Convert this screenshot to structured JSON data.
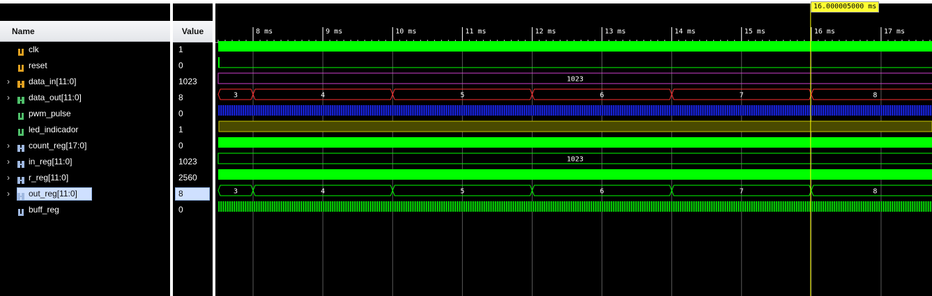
{
  "header": {
    "name_col": "Name",
    "value_col": "Value"
  },
  "signals": [
    {
      "name": "clk",
      "value": "1",
      "bus": false,
      "icon": "bit-signal-icon",
      "icon_color": "#e0a020"
    },
    {
      "name": "reset",
      "value": "0",
      "bus": false,
      "icon": "bit-signal-icon",
      "icon_color": "#e0a020"
    },
    {
      "name": "data_in[11:0]",
      "value": "1023",
      "bus": true,
      "icon": "bus-input-icon",
      "icon_color": "#e0a020"
    },
    {
      "name": "data_out[11:0]",
      "value": "8",
      "bus": true,
      "icon": "bus-output-icon",
      "icon_color": "#4fbf6a"
    },
    {
      "name": "pwm_pulse",
      "value": "0",
      "bus": false,
      "icon": "bit-output-icon",
      "icon_color": "#4fbf6a"
    },
    {
      "name": "led_indicador",
      "value": "1",
      "bus": false,
      "icon": "bit-output-icon",
      "icon_color": "#4fbf6a"
    },
    {
      "name": "count_reg[17:0]",
      "value": "0",
      "bus": true,
      "icon": "bus-reg-icon",
      "icon_color": "#9fb8e0"
    },
    {
      "name": "in_reg[11:0]",
      "value": "1023",
      "bus": true,
      "icon": "bus-reg-icon",
      "icon_color": "#9fb8e0"
    },
    {
      "name": "r_reg[11:0]",
      "value": "2560",
      "bus": true,
      "icon": "bus-reg-icon",
      "icon_color": "#9fb8e0"
    },
    {
      "name": "out_reg[11:0]",
      "value": "8",
      "bus": true,
      "icon": "bus-reg-icon",
      "icon_color": "#9fb8e0",
      "selected": true
    },
    {
      "name": "buff_reg",
      "value": "0",
      "bus": false,
      "icon": "bit-reg-icon",
      "icon_color": "#9fb8e0"
    }
  ],
  "timeline": {
    "ticks": [
      "8 ms",
      "9 ms",
      "10 ms",
      "11 ms",
      "12 ms",
      "13 ms",
      "14 ms",
      "15 ms",
      "16 ms",
      "17 ms"
    ],
    "cursor_label": "16.000005000 ms",
    "cursor_time_ms": 16.000005
  },
  "waves": {
    "data_in_value": "1023",
    "data_out_segments": [
      "3",
      "4",
      "5",
      "6",
      "7",
      "8"
    ],
    "in_reg_value": "1023",
    "out_reg_segments": [
      "3",
      "4",
      "5",
      "6",
      "7",
      "8"
    ]
  },
  "colors": {
    "wave_green": "#00ff00",
    "wave_red": "#ff3030",
    "wave_purple": "#d040d0",
    "wave_blue": "#1a2bff",
    "wave_olive": "#4a4a00",
    "cursor": "#ffff00",
    "selection": "#cfe0ff"
  }
}
